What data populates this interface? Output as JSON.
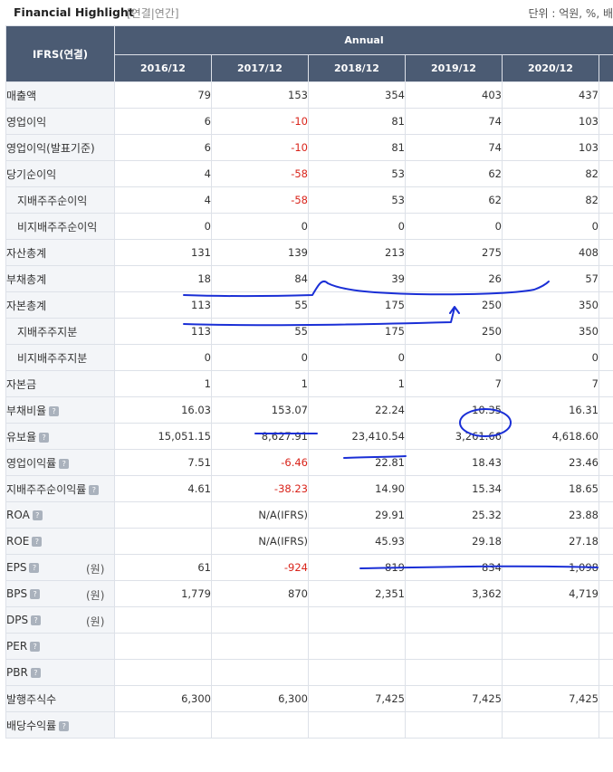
{
  "header": {
    "title": "Financial Highlight",
    "subtitle": "[연결|연간]",
    "unit_note": "단위 : 억원, %, 배"
  },
  "table": {
    "corner_label": "IFRS(연결)",
    "group_label": "Annual",
    "columns": [
      "2016/12",
      "2017/12",
      "2018/12",
      "2019/12",
      "2020/12"
    ],
    "rows": [
      {
        "label": "매출액",
        "values": [
          "79",
          "153",
          "354",
          "403",
          "437"
        ]
      },
      {
        "label": "영업이익",
        "values": [
          "6",
          "-10",
          "81",
          "74",
          "103"
        ]
      },
      {
        "label": "영업이익(발표기준)",
        "values": [
          "6",
          "-10",
          "81",
          "74",
          "103"
        ]
      },
      {
        "label": "당기순이익",
        "values": [
          "4",
          "-58",
          "53",
          "62",
          "82"
        ]
      },
      {
        "label": "지배주주순이익",
        "values": [
          "4",
          "-58",
          "53",
          "62",
          "82"
        ]
      },
      {
        "label": "비지배주주순이익",
        "values": [
          "0",
          "0",
          "0",
          "0",
          "0"
        ]
      },
      {
        "label": "자산총계",
        "values": [
          "131",
          "139",
          "213",
          "275",
          "408"
        ]
      },
      {
        "label": "부채총계",
        "values": [
          "18",
          "84",
          "39",
          "26",
          "57"
        ]
      },
      {
        "label": "자본총계",
        "values": [
          "113",
          "55",
          "175",
          "250",
          "350"
        ]
      },
      {
        "label": "지배주주지분",
        "values": [
          "113",
          "55",
          "175",
          "250",
          "350"
        ]
      },
      {
        "label": "비지배주주지분",
        "values": [
          "0",
          "0",
          "0",
          "0",
          "0"
        ]
      },
      {
        "label": "자본금",
        "values": [
          "1",
          "1",
          "1",
          "7",
          "7"
        ]
      },
      {
        "label": "부채비율",
        "values": [
          "16.03",
          "153.07",
          "22.24",
          "10.35",
          "16.31"
        ]
      },
      {
        "label": "유보율",
        "values": [
          "15,051.15",
          "8,627.91",
          "23,410.54",
          "3,261.66",
          "4,618.60"
        ]
      },
      {
        "label": "영업이익률",
        "values": [
          "7.51",
          "-6.46",
          "22.81",
          "18.43",
          "23.46"
        ]
      },
      {
        "label": "지배주주순이익률",
        "values": [
          "4.61",
          "-38.23",
          "14.90",
          "15.34",
          "18.65"
        ]
      },
      {
        "label": "ROA",
        "values": [
          "",
          "N/A(IFRS)",
          "29.91",
          "25.32",
          "23.88"
        ]
      },
      {
        "label": "ROE",
        "values": [
          "",
          "N/A(IFRS)",
          "45.93",
          "29.18",
          "27.18"
        ]
      },
      {
        "label": "EPS",
        "unit": "(원)",
        "values": [
          "61",
          "-924",
          "819",
          "834",
          "1,098"
        ]
      },
      {
        "label": "BPS",
        "unit": "(원)",
        "values": [
          "1,779",
          "870",
          "2,351",
          "3,362",
          "4,719"
        ]
      },
      {
        "label": "DPS",
        "unit": "(원)",
        "values": [
          "",
          "",
          "",
          "",
          ""
        ]
      },
      {
        "label": "PER",
        "values": [
          "",
          "",
          "",
          "",
          ""
        ]
      },
      {
        "label": "PBR",
        "values": [
          "",
          "",
          "",
          "",
          ""
        ]
      },
      {
        "label": "발행주식수",
        "values": [
          "6,300",
          "6,300",
          "7,425",
          "7,425",
          "7,425"
        ]
      },
      {
        "label": "배당수익률",
        "values": [
          "",
          "",
          "",
          "",
          ""
        ]
      }
    ]
  },
  "colors": {
    "header_bg": "#4b5b73",
    "negative": "#d9241b",
    "annotation": "#1a2fd6"
  }
}
